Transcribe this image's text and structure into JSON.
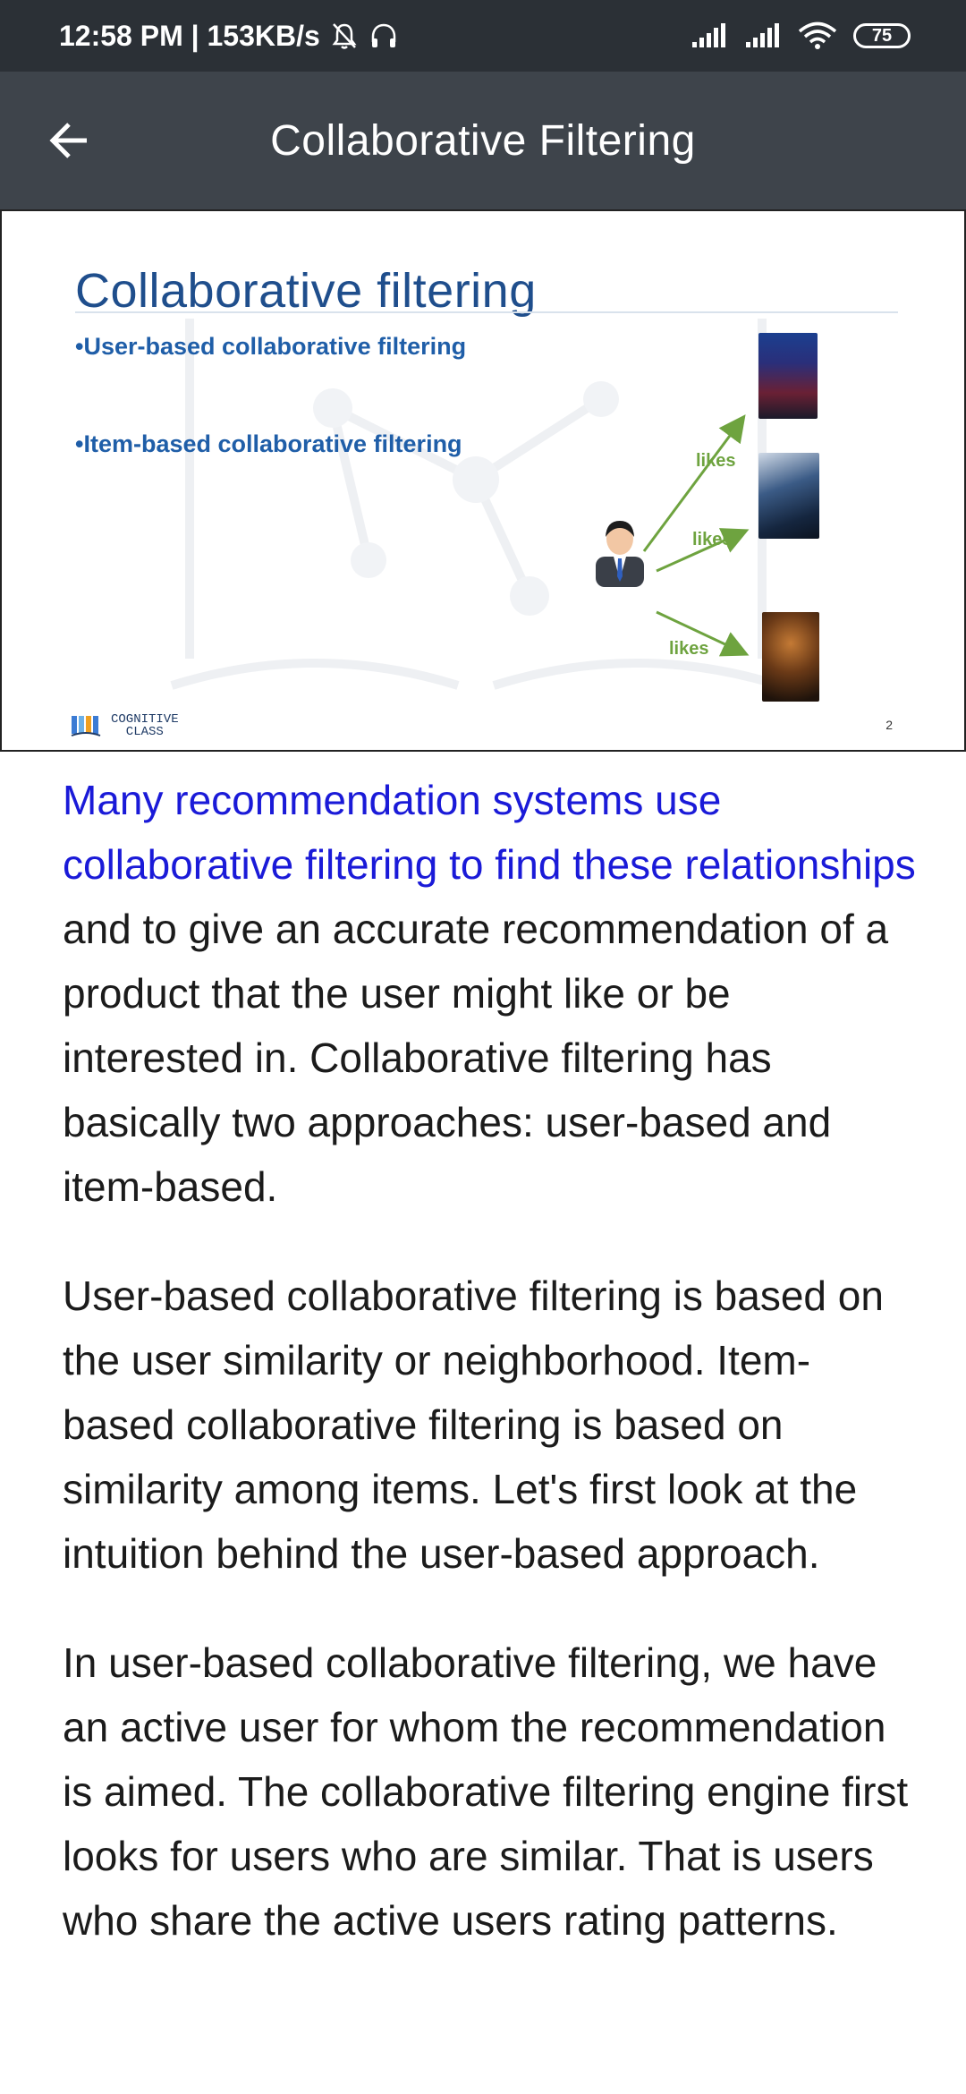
{
  "status_bar": {
    "time_speed": "12:58 PM | 153KB/s",
    "battery": "75"
  },
  "app_bar": {
    "title": "Collaborative Filtering",
    "back_icon": "arrow-left-icon"
  },
  "slide": {
    "title": "Collaborative filtering",
    "bullets": [
      "User-based collaborative filtering",
      "Item-based collaborative filtering"
    ],
    "likes_labels": [
      "likes",
      "likes",
      "likes"
    ],
    "logo_line1": "COGNITIVE",
    "logo_line2": "CLASS",
    "page_number": "2",
    "user_icon": "user-avatar-icon",
    "colors": {
      "title": "#1f4e8c",
      "bullet": "#1f5ea8",
      "arrow": "#6ea33f"
    }
  },
  "article": {
    "p1_link": "Many recommendation systems use collaborative filtering to find these relationships",
    "p1_rest": " and to give an accurate recommendation of a product that the user might like or be interested in. Collaborative filtering has basically two approaches: user-based and item-based.",
    "p2": "User-based collaborative filtering is based on the user similarity or neighborhood. Item-based collaborative filtering is based on similarity among items. Let's first look at the intuition behind the user-based approach.",
    "p3": "In user-based collaborative filtering, we have an active user for whom the recommendation is aimed. The collaborative filtering engine first looks for users who are similar. That is users who share the active users rating patterns."
  }
}
